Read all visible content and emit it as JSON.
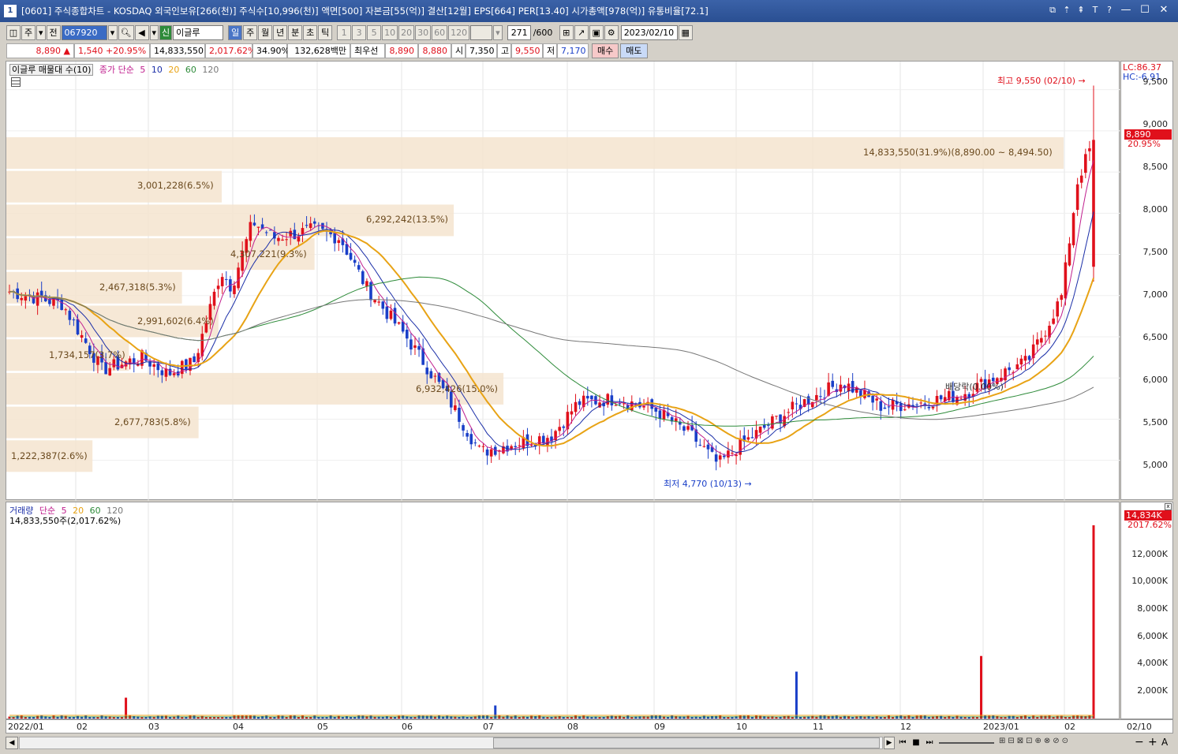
{
  "window": {
    "title": "[0601] 주식종합차트 - KOSDAQ 외국인보유[266(천)] 주식수[10,996(천)] 액면[500] 자본금[55(억)] 결산[12월] EPS[664] PER[13.40] 시가총액[978(억)] 유통비율[72.1]",
    "number": "1"
  },
  "toolbar": {
    "mode": "주",
    "prev_label": "전",
    "code": "067920",
    "new_badge": "신",
    "stock_name": "이글루",
    "periods": [
      "일",
      "주",
      "월",
      "년",
      "분",
      "초",
      "틱"
    ],
    "minutes": [
      "1",
      "3",
      "5",
      "10",
      "20",
      "30",
      "60",
      "120"
    ],
    "count": "271",
    "count_total": "/600",
    "date": "2023/02/10"
  },
  "quote": {
    "price": "8,890",
    "change_arrow": "▲",
    "change": "1,540",
    "change_pct": "+20.95%",
    "volume": "14,833,550",
    "volume_pct": "2,017.62%",
    "turnover": "34.90%",
    "amount": "132,628백만",
    "best_label": "최우선",
    "ask": "8,890",
    "bid": "8,880",
    "open_label": "시",
    "open": "7,350",
    "high_label": "고",
    "high": "9,550",
    "low_label": "저",
    "low": "7,170",
    "buy_label": "매수",
    "sell_label": "매도"
  },
  "main_legend": {
    "title": "이글루 매물대 수(10)",
    "ma_label": "종가 단순",
    "ma": [
      "5",
      "10",
      "20",
      "60",
      "120"
    ]
  },
  "volume_legend": {
    "title": "거래량",
    "ma_label": "단순",
    "ma": [
      "5",
      "20",
      "60",
      "120"
    ],
    "current": "14,833,550주(2,017.62%)"
  },
  "price_axis": {
    "labels": [
      "9,500",
      "9,000",
      "8,500",
      "8,000",
      "7,500",
      "7,000",
      "6,500",
      "6,000",
      "5,500",
      "5,000"
    ],
    "lc": "LC:86.37",
    "hc": "HC:-6.91",
    "last_price": "8,890",
    "last_pct": "20.95%"
  },
  "volume_axis": {
    "labels": [
      "12,000K",
      "10,000K",
      "8,000K",
      "6,000K",
      "4,000K",
      "2,000K"
    ],
    "last_vol": "14,834K",
    "last_pct": "2017.62%"
  },
  "date_axis": {
    "labels": [
      "2022/01",
      "02",
      "03",
      "04",
      "05",
      "06",
      "07",
      "08",
      "09",
      "10",
      "11",
      "12",
      "2023/01",
      "02"
    ],
    "right_label": "02/10"
  },
  "annotations": {
    "high": "최고 9,550 (02/10)",
    "low": "최저 4,770 (10/13)",
    "dividend": "배당락(0.00%)"
  },
  "volume_profile": [
    {
      "label": "14,833,550(31.9%)(8,890.00 ~ 8,494.50)",
      "pct": 31.9
    },
    {
      "label": "3,001,228(6.5%)",
      "pct": 6.5
    },
    {
      "label": "6,292,242(13.5%)",
      "pct": 13.5
    },
    {
      "label": "4,307,221(9.3%)",
      "pct": 9.3
    },
    {
      "label": "2,467,318(5.3%)",
      "pct": 5.3
    },
    {
      "label": "2,991,602(6.4%)",
      "pct": 6.4
    },
    {
      "label": "1,734,157(3.7%)",
      "pct": 3.7
    },
    {
      "label": "6,932,426(15.0%)",
      "pct": 15.0
    },
    {
      "label": "2,677,783(5.8%)",
      "pct": 5.8
    },
    {
      "label": "1,222,387(2.6%)",
      "pct": 2.6
    }
  ],
  "colors": {
    "up": "#e0101b",
    "down": "#1a3fc8",
    "ma5": "#c0208f",
    "ma10": "#1b2fa8",
    "ma20": "#e8a315",
    "ma60": "#2e8b3a",
    "ma120": "#777777",
    "profile": "#f5e4cf"
  },
  "chart_data": {
    "type": "candlestick",
    "title": "이글루",
    "ylim": [
      4700,
      9600
    ],
    "monthly_close": [
      {
        "month": "2022/01",
        "close": 6200
      },
      {
        "month": "02",
        "close": 6100
      },
      {
        "month": "03",
        "close": 7200
      },
      {
        "month": "04",
        "close": 7800
      },
      {
        "month": "05",
        "close": 6700
      },
      {
        "month": "06",
        "close": 5300
      },
      {
        "month": "07",
        "close": 5300
      },
      {
        "month": "08",
        "close": 5700
      },
      {
        "month": "09",
        "close": 5600
      },
      {
        "month": "10",
        "close": 5000
      },
      {
        "month": "11",
        "close": 5800
      },
      {
        "month": "12",
        "close": 5700
      },
      {
        "month": "2023/01",
        "close": 6100
      },
      {
        "month": "02",
        "close": 8890
      }
    ],
    "last": {
      "open": 7350,
      "high": 9550,
      "low": 7170,
      "close": 8890,
      "volume": 14833550
    }
  },
  "statusbar": {
    "icons": [
      "prev-icon",
      "rewind-icon",
      "stop-icon",
      "forward-icon",
      "zoom-out-icon",
      "zoom-in-icon",
      "settings-icon"
    ]
  }
}
